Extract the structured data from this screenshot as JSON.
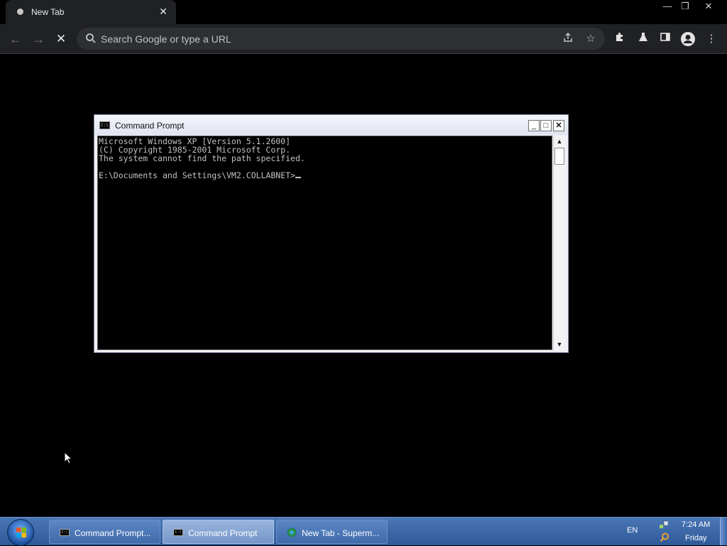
{
  "browser": {
    "tab": {
      "title": "New Tab",
      "close_glyph": "✕"
    },
    "window_controls": {
      "minimize": "—",
      "restore": "❐",
      "close": "✕"
    },
    "toolbar": {
      "back_glyph": "←",
      "forward_glyph": "→",
      "stop_glyph": "✕",
      "omnibox_placeholder": "Search Google or type a URL",
      "icons": [
        "share-icon",
        "bookmark-star-icon",
        "extensions-icon",
        "labs-flask-icon",
        "side-panel-icon",
        "profile-avatar-icon",
        "menu-kebab-icon"
      ]
    }
  },
  "cmd": {
    "title": "Command Prompt",
    "app_icon_text": "C:\\",
    "controls": {
      "minimize": "_",
      "maximize": "□",
      "close": "✕"
    },
    "lines": [
      "Microsoft Windows XP [Version 5.1.2600]",
      "(C) Copyright 1985-2001 Microsoft Corp.",
      "The system cannot find the path specified.",
      "",
      "E:\\Documents and Settings\\VM2.COLLABNET>"
    ]
  },
  "taskbar": {
    "tasks": [
      {
        "label": "Command Prompt...",
        "icon": "cmd-icon",
        "active": false
      },
      {
        "label": "Command Prompt",
        "icon": "cmd-icon",
        "active": true
      },
      {
        "label": "New Tab - Superm...",
        "icon": "chrome-icon",
        "active": false
      }
    ],
    "tray": {
      "language": "EN",
      "time": "7:24 AM",
      "day": "Friday"
    }
  },
  "colors": {
    "desktop_bg": "#000000",
    "chrome_toolbar": "#202124",
    "taskbar": "#3a66a6",
    "console_text": "#c0c0c0"
  }
}
